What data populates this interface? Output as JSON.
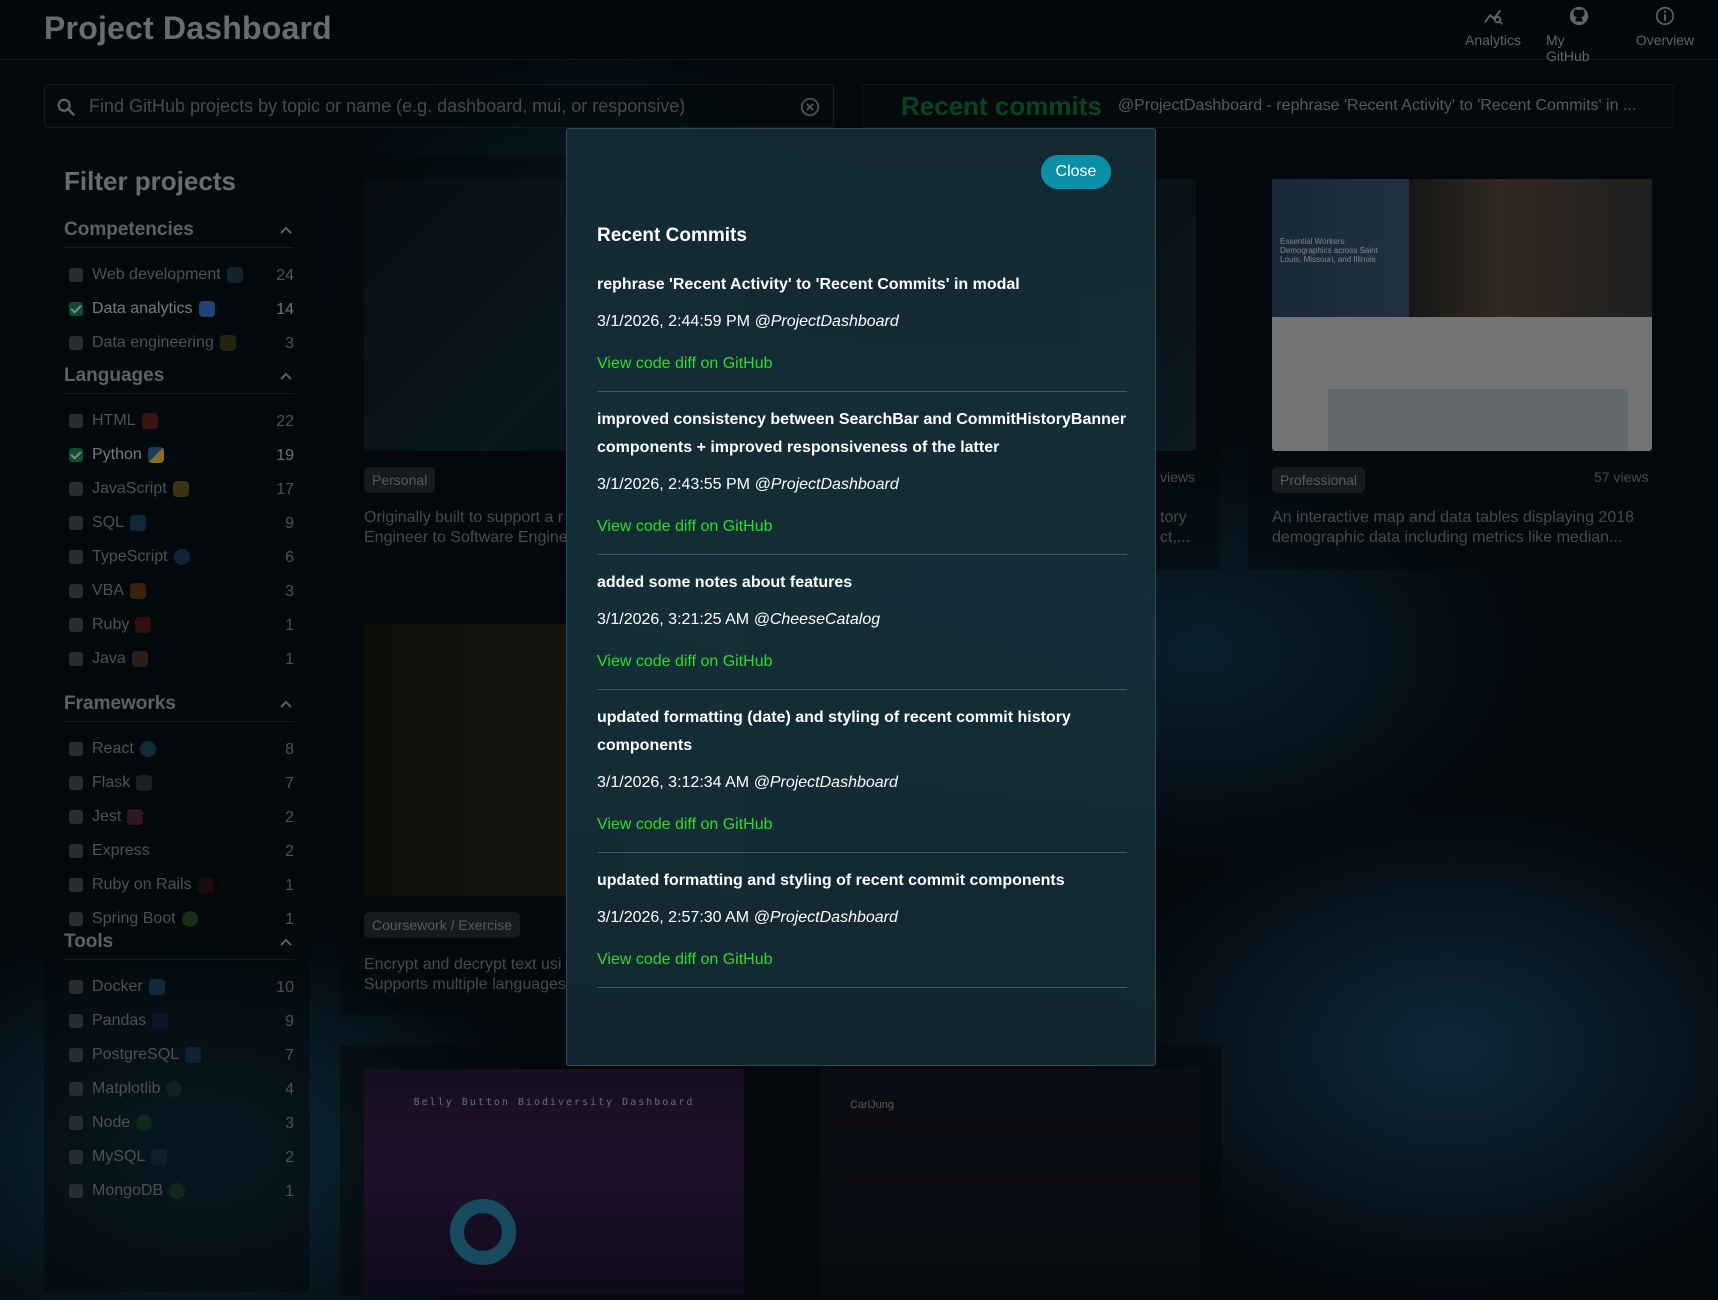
{
  "header": {
    "title": "Project Dashboard",
    "nav": [
      {
        "label": "Analytics",
        "icon": "analytics-icon"
      },
      {
        "label": "My GitHub",
        "icon": "github-icon"
      },
      {
        "label": "Overview",
        "icon": "info-icon"
      }
    ]
  },
  "search": {
    "placeholder": "Find GitHub projects by topic or name (e.g. dashboard, mui, or responsive)"
  },
  "banner": {
    "title": "Recent commits",
    "text": "@ProjectDashboard - rephrase 'Recent Activity' to 'Recent Commits' in ..."
  },
  "sidebar": {
    "title": "Filter projects",
    "sections": [
      {
        "title": "Competencies",
        "items": [
          {
            "label": "Web development",
            "count": "24",
            "checked": false
          },
          {
            "label": "Data analytics",
            "count": "14",
            "checked": true
          },
          {
            "label": "Data engineering",
            "count": "3",
            "checked": false
          }
        ]
      },
      {
        "title": "Languages",
        "items": [
          {
            "label": "HTML",
            "count": "22",
            "checked": false
          },
          {
            "label": "Python",
            "count": "19",
            "checked": true
          },
          {
            "label": "JavaScript",
            "count": "17",
            "checked": false
          },
          {
            "label": "SQL",
            "count": "9",
            "checked": false
          },
          {
            "label": "TypeScript",
            "count": "6",
            "checked": false
          },
          {
            "label": "VBA",
            "count": "3",
            "checked": false
          },
          {
            "label": "Ruby",
            "count": "1",
            "checked": false
          },
          {
            "label": "Java",
            "count": "1",
            "checked": false
          }
        ]
      },
      {
        "title": "Frameworks",
        "items": [
          {
            "label": "React",
            "count": "8",
            "checked": false
          },
          {
            "label": "Flask",
            "count": "7",
            "checked": false
          },
          {
            "label": "Jest",
            "count": "2",
            "checked": false
          },
          {
            "label": "Express",
            "count": "2",
            "checked": false
          },
          {
            "label": "Ruby on Rails",
            "count": "1",
            "checked": false
          },
          {
            "label": "Spring Boot",
            "count": "1",
            "checked": false
          }
        ]
      },
      {
        "title": "Tools",
        "items": [
          {
            "label": "Docker",
            "count": "10",
            "checked": false
          },
          {
            "label": "Pandas",
            "count": "9",
            "checked": false
          },
          {
            "label": "PostgreSQL",
            "count": "7",
            "checked": false
          },
          {
            "label": "Matplotlib",
            "count": "4",
            "checked": false
          },
          {
            "label": "Node",
            "count": "3",
            "checked": false
          },
          {
            "label": "MySQL",
            "count": "2",
            "checked": false
          },
          {
            "label": "MongoDB",
            "count": "1",
            "checked": false
          }
        ]
      }
    ]
  },
  "cards": {
    "card1": {
      "tag": "Personal",
      "desc_line1": "Originally built to support a r",
      "desc_line2": "Engineer to Software Engine"
    },
    "card2": {
      "views": "views",
      "desc_line1": "tory",
      "desc_line2": "ct,..."
    },
    "card3": {
      "tag": "Professional",
      "views": "57 views",
      "desc_line1": "An interactive map and data tables displaying 2018",
      "desc_line2": "demographic data including metrics like median...",
      "shot_caption": "Essential Workers: Demographics across Saint Louis, Missouri, and Illinois"
    },
    "card4": {
      "tag": "Coursework / Exercise",
      "desc_line1": "Encrypt and decrypt text usi",
      "desc_line2": "Supports multiple languages"
    },
    "card6": {
      "shot_caption": "Belly Button Biodiversity Dashboard"
    },
    "card7": {
      "shot_caption": "CarlJung"
    }
  },
  "modal": {
    "close_label": "Close",
    "title": "Recent Commits",
    "link_label": "View code diff on GitHub",
    "commits": [
      {
        "message": "rephrase 'Recent Activity' to 'Recent Commits' in modal",
        "date": "3/1/2026, 2:44:59 PM",
        "author": "@ProjectDashboard"
      },
      {
        "message": "improved consistency between SearchBar and CommitHistoryBanner components + improved responsiveness of the latter",
        "date": "3/1/2026, 2:43:55 PM",
        "author": "@ProjectDashboard"
      },
      {
        "message": "added some notes about features",
        "date": "3/1/2026, 3:21:25 AM",
        "author": "@CheeseCatalog"
      },
      {
        "message": "updated formatting (date) and styling of recent commit history components",
        "date": "3/1/2026, 3:12:34 AM",
        "author": "@ProjectDashboard"
      },
      {
        "message": "updated formatting and styling of recent commit components",
        "date": "3/1/2026, 2:57:30 AM",
        "author": "@ProjectDashboard"
      }
    ]
  },
  "colors": {
    "accent": "#0a8fa7",
    "link": "#2bdc2b",
    "banner_title": "#0b7d3a",
    "checked": "#1b8a5a"
  }
}
